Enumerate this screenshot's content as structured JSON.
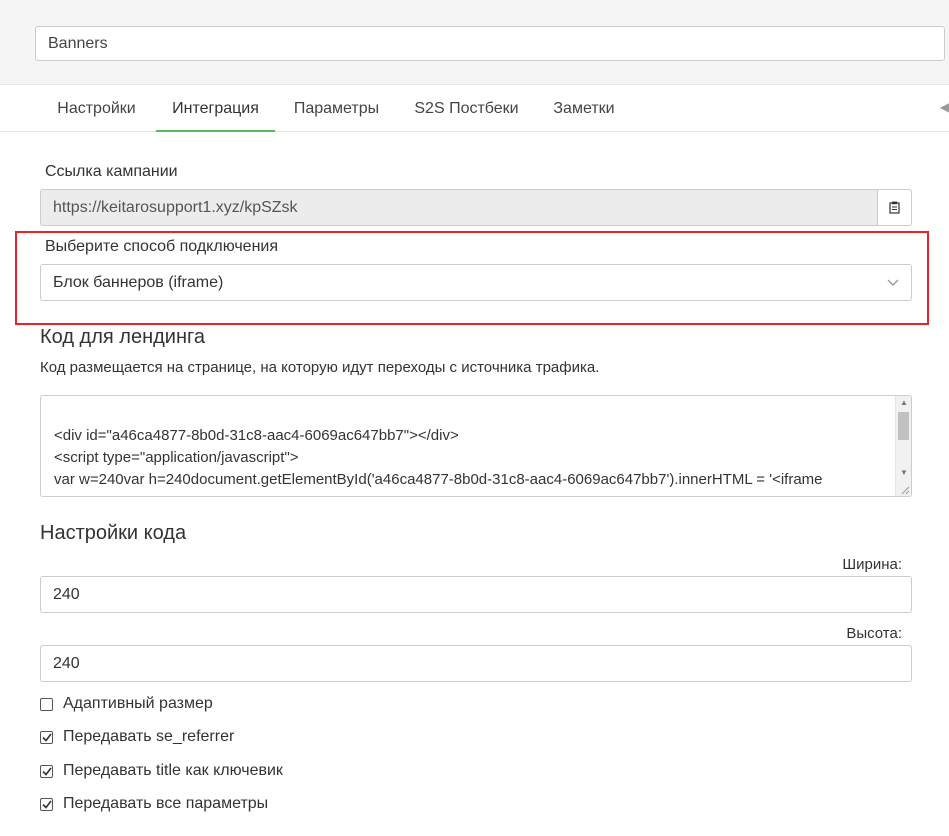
{
  "header": {
    "name_value": "Banners"
  },
  "tabs": [
    {
      "label": "Настройки"
    },
    {
      "label": "Интеграция"
    },
    {
      "label": "Параметры"
    },
    {
      "label": "S2S Постбеки"
    },
    {
      "label": "Заметки"
    }
  ],
  "campaign_link": {
    "label": "Ссылка кампании",
    "value": "https://keitarosupport1.xyz/kpSZsk"
  },
  "connection": {
    "label": "Выберите способ подключения",
    "selected": "Блок баннеров (iframe)"
  },
  "landing_code": {
    "title": "Код для лендинга",
    "description": "Код размещается на странице, на которую идут переходы с источника трафика.",
    "lines": [
      "<div id=\"a46ca4877-8b0d-31c8-aac4-6069ac647bb7\"></div>",
      "<script type=\"application/javascript\">",
      "var w=240var h=240document.getElementById('a46ca4877-8b0d-31c8-aac4-6069ac647bb7').innerHTML = '<iframe"
    ]
  },
  "code_settings": {
    "title": "Настройки кода",
    "width_label": "Ширина:",
    "width_value": "240",
    "height_label": "Высота:",
    "height_value": "240"
  },
  "options": [
    {
      "label": "Адаптивный размер",
      "checked": false
    },
    {
      "label": "Передавать se_referrer",
      "checked": true
    },
    {
      "label": "Передавать title как ключевик",
      "checked": true
    },
    {
      "label": "Передавать все параметры",
      "checked": true
    }
  ],
  "colors": {
    "accent": "#5cb85c",
    "highlight": "#e8232a"
  }
}
